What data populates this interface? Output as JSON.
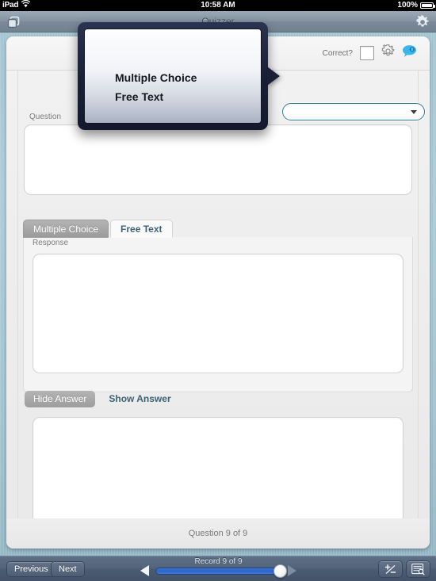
{
  "status_bar": {
    "device": "iPad",
    "wifi_icon": "wifi-icon",
    "time": "10:58 AM",
    "battery_percent": "100%",
    "battery_icon": "battery-icon"
  },
  "title_bar": {
    "left_icon": "layers-copy-icon",
    "title": "Quizzer",
    "right_icon": "gear-icon"
  },
  "record_header": {
    "correct_label": "Correct?",
    "correct_checked": false,
    "gear_icon": "gear-icon",
    "comment_icon": "speech-bubble-icon"
  },
  "type_dropdown": {
    "value": "",
    "placeholder": "",
    "arrow_icon": "chevron-down-icon"
  },
  "popover": {
    "arrow_icon": "popover-arrow",
    "items": [
      {
        "label": "Multiple Choice"
      },
      {
        "label": "Free Text"
      }
    ]
  },
  "question_section": {
    "label": "Question",
    "value": ""
  },
  "answer_tabs": {
    "tabs": [
      {
        "label": "Multiple Choice",
        "active": false
      },
      {
        "label": "Free Text",
        "active": true
      }
    ]
  },
  "response_section": {
    "label": "Response",
    "value": ""
  },
  "answer_toggle": {
    "buttons": [
      {
        "label": "Hide Answer",
        "active": false
      },
      {
        "label": "Show Answer",
        "active": true
      }
    ],
    "value": ""
  },
  "card_footer": {
    "question_counter": "Question 9 of 9"
  },
  "toolbar": {
    "previous_label": "Previous",
    "next_label": "Next",
    "record_counter": "Record 9 of 9",
    "prev_arrow_icon": "triangle-left-icon",
    "next_arrow_icon": "triangle-right-icon",
    "slider_value": "9",
    "slider_min": "1",
    "slider_max": "9",
    "plus_minus_icon": "plus-minus-icon",
    "find_records_icon": "list-search-icon"
  },
  "colors": {
    "accent_blue": "#3b6375",
    "slider_blue": "#2f63c4",
    "toolbar_navy": "#4b5b72",
    "dropdown_border": "#2b7f94",
    "popover_border": "#1a2137",
    "wallpaper": "#9ec4d2"
  }
}
